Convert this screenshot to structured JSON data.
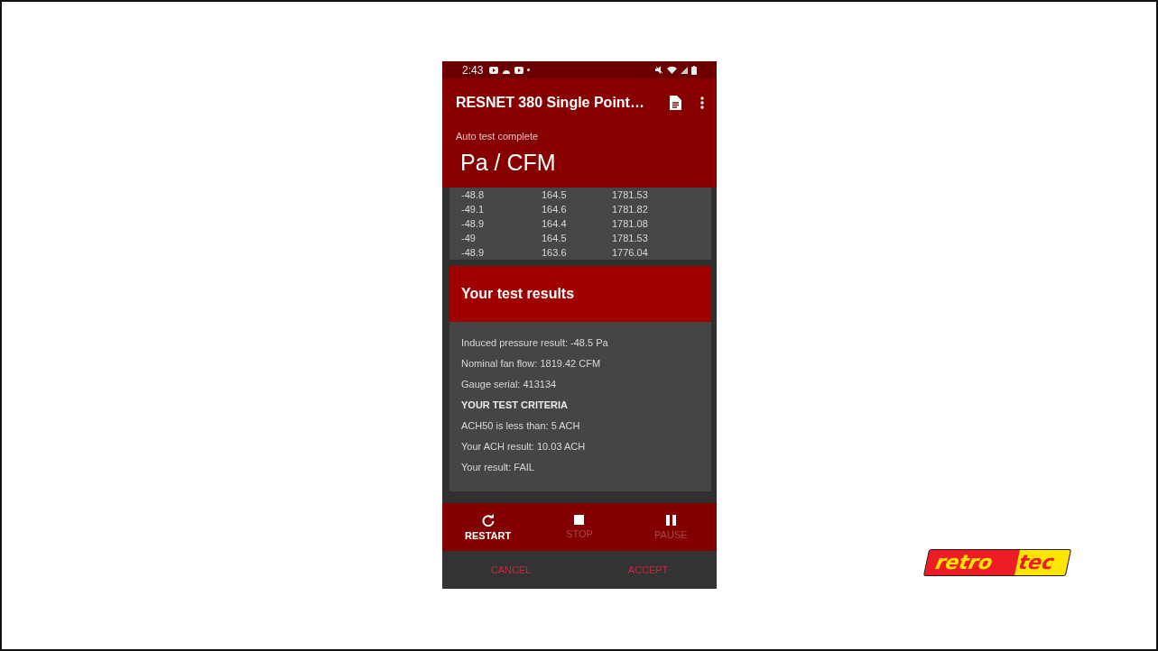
{
  "status_bar": {
    "time": "2:43"
  },
  "app_bar": {
    "title": "RESNET 380 Single Point…"
  },
  "header": {
    "status": "Auto test complete",
    "units": "Pa / CFM"
  },
  "readings": [
    {
      "pressure": "-48.8",
      "column_2": "164.5",
      "column_3": "1781.53"
    },
    {
      "pressure": "-49.1",
      "column_2": "164.6",
      "column_3": "1781.82"
    },
    {
      "pressure": "-48.9",
      "column_2": "164.4",
      "column_3": "1781.08"
    },
    {
      "pressure": "-49",
      "column_2": "164.5",
      "column_3": "1781.53"
    },
    {
      "pressure": "-48.9",
      "column_2": "163.6",
      "column_3": "1776.04"
    }
  ],
  "results": {
    "title": "Your test results",
    "lines": [
      {
        "kind": "line",
        "text": "Induced pressure result: -48.5 Pa"
      },
      {
        "kind": "line",
        "text": "Nominal fan flow: 1819.42 CFM"
      },
      {
        "kind": "line",
        "text": "Gauge serial: 413134"
      },
      {
        "kind": "heading",
        "text": "YOUR TEST CRITERIA"
      },
      {
        "kind": "line",
        "text": "ACH50 is less than: 5 ACH"
      },
      {
        "kind": "line",
        "text": "Your ACH result: 10.03 ACH"
      },
      {
        "kind": "line",
        "text": "Your result: FAIL"
      }
    ]
  },
  "controls": [
    {
      "kind": "restart",
      "label": "RESTART",
      "disabled": false
    },
    {
      "kind": "stop",
      "label": "STOP",
      "disabled": true
    },
    {
      "kind": "pause",
      "label": "PAUSE",
      "disabled": true
    }
  ],
  "dialog_buttons": [
    "CANCEL",
    "ACCEPT"
  ],
  "logo": {
    "left": "retro",
    "right": "tec"
  }
}
